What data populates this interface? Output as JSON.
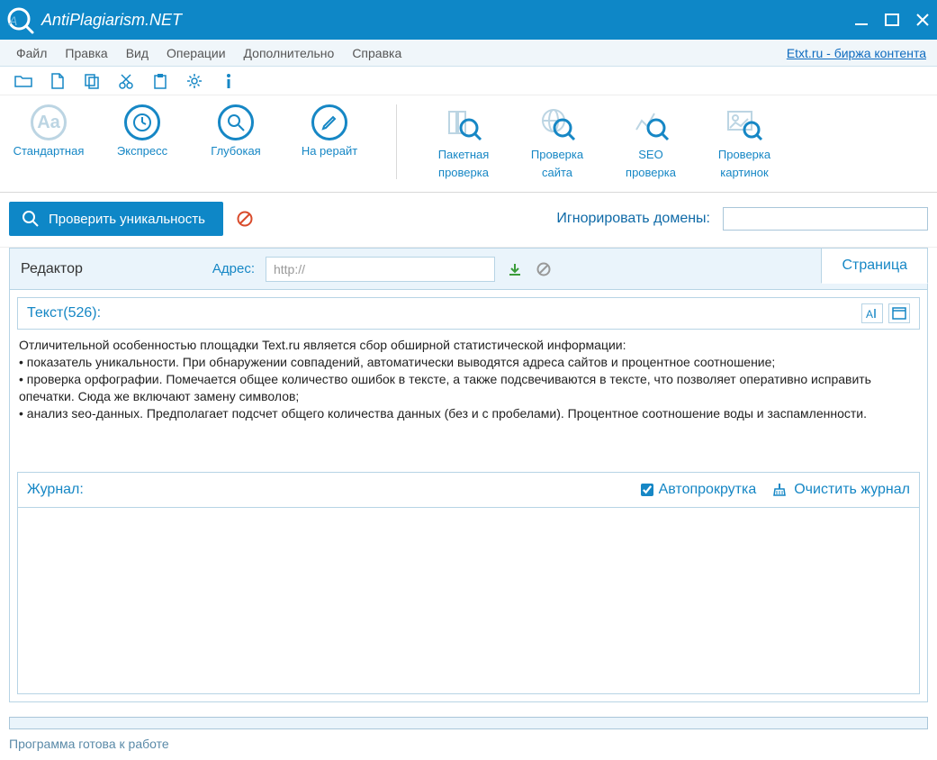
{
  "title": "AntiPlagiarism.NET",
  "menu": {
    "file": "Файл",
    "edit": "Правка",
    "view": "Вид",
    "ops": "Операции",
    "extra": "Дополнительно",
    "help": "Справка",
    "etxt": "Etxt.ru - биржа контента"
  },
  "modes": {
    "standard": "Стандартная",
    "express": "Экспресс",
    "deep": "Глубокая",
    "rewrite": "На рерайт",
    "batch_l1": "Пакетная",
    "batch_l2": "проверка",
    "site_l1": "Проверка",
    "site_l2": "сайта",
    "seo_l1": "SEO",
    "seo_l2": "проверка",
    "img_l1": "Проверка",
    "img_l2": "картинок"
  },
  "checkrow": {
    "button": "Проверить уникальность",
    "ignore_label": "Игнорировать домены:",
    "ignore_value": ""
  },
  "editor": {
    "label": "Редактор",
    "addr_label": "Адрес:",
    "addr_value": "http://",
    "page_tab": "Страница",
    "text_hdr": "Текст(526):",
    "text_body": "Отличительной особенностью площадки Text.ru является сбор обширной статистической информации:\n• показатель уникальности. При обнаружении совпадений, автоматически выводятся адреса сайтов и процентное соотношение;\n• проверка орфографии. Помечается общее количество ошибок в тексте, а также подсвечиваются в тексте, что позволяет оперативно исправить опечатки. Сюда же включают замену символов;\n• анализ seo-данных. Предполагает подсчет общего количества данных (без и с пробелами). Процентное соотношение воды и заспамленности.",
    "journal_label": "Журнал:",
    "autoscroll": "Автопрокрутка",
    "clear_journal": "Очистить журнал"
  },
  "status": "Программа готова к работе"
}
